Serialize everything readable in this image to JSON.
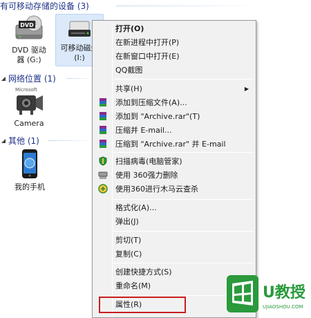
{
  "groups": {
    "removable": {
      "title": "有可移动存储的设备 (3)"
    },
    "network": {
      "title": "网络位置 (1)"
    },
    "other": {
      "title": "其他 (1)"
    }
  },
  "items": {
    "dvd": {
      "label": "DVD 驱动\n器 (G:)",
      "icon_text": "DVD"
    },
    "removable_disk": {
      "label": "可移动磁盘\n(I:)"
    },
    "camera": {
      "label": "Camera",
      "icon_text": "Microsoft"
    },
    "phone": {
      "label": "我的手机"
    }
  },
  "context_menu": {
    "open": "打开(O)",
    "open_new_process": "在新进程中打开(P)",
    "open_new_window": "在新窗口中打开(E)",
    "qq_screenshot": "QQ截图",
    "share": "共享(H)",
    "add_to_archive": "添加到压缩文件(A)...",
    "add_to_archive_rar": "添加到 \"Archive.rar\"(T)",
    "compress_email": "压缩并 E-mail...",
    "compress_rar_email": "压缩到 \"Archive.rar\" 并 E-mail",
    "scan_virus": "扫描病毒(电脑管家)",
    "force_delete_360": "使用 360强力删除",
    "trojan_scan_360": "使用360进行木马云查杀",
    "format": "格式化(A)...",
    "eject": "弹出(J)",
    "cut": "剪切(T)",
    "copy": "复制(C)",
    "create_shortcut": "创建快捷方式(S)",
    "rename": "重命名(M)",
    "properties": "属性(R)"
  },
  "watermark": {
    "brand": "U教授",
    "url": "UJIAOSHOU.COM"
  },
  "colors": {
    "header_text": "#1e3287",
    "highlight": "#c81e1e",
    "brand_green": "#2a9a3c"
  }
}
